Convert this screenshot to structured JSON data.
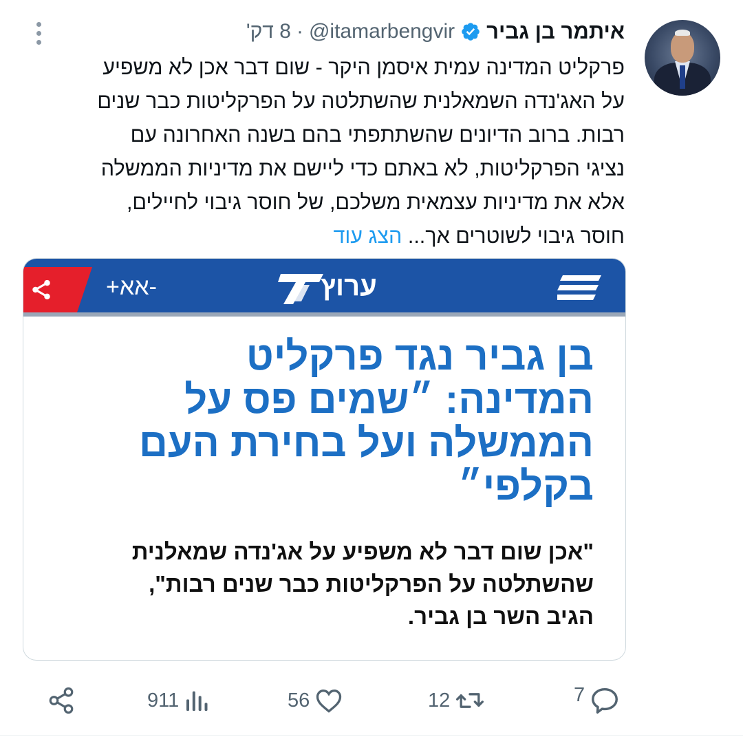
{
  "tweet": {
    "author_name": "איתמר בן גביר",
    "handle": "@itamarbengvir",
    "separator": "·",
    "time_ago": "8 דק'",
    "text_lines": [
      "פרקליט המדינה עמית איסמן היקר - שום דבר אכן לא משפיע",
      "על האג'נדה השמאלנית שהשתלטה על הפרקליטות כבר שנים",
      "רבות. ברוב הדיונים שהשתתפתי בהם בשנה האחרונה עם",
      "נציגי הפרקליטות, לא באתם כדי ליישם את מדיניות הממשלה",
      "אלא את מדיניות עצמאית משלכם, של חוסר גיבוי לחיילים,",
      "חוסר גיבוי לשוטרים אך..."
    ],
    "show_more": "הצג עוד"
  },
  "card": {
    "site_name": "ערוץ",
    "font_control": "+אא-",
    "headline_lines": [
      "בן גביר נגד פרקליט",
      "המדינה: ״שמים פס על",
      "הממשלה ועל בחירת העם",
      "בקלפי״"
    ],
    "quote_lines": [
      "\"אכן שום דבר לא משפיע על אג'נדה שמאלנית",
      "שהשתלטה על הפרקליטות כבר שנים רבות\",",
      "הגיב השר בן גביר."
    ],
    "colors": {
      "bar": "#1c54a6",
      "accent_red": "#e51f2b",
      "headline": "#1c6fc4"
    }
  },
  "actions": {
    "replies": "7",
    "reposts": "12",
    "likes": "56",
    "views": "911"
  },
  "icons": [
    "verified-badge-icon",
    "more-options-icon",
    "share-icon",
    "menu-icon",
    "reply-icon",
    "repost-icon",
    "like-icon",
    "views-icon"
  ]
}
